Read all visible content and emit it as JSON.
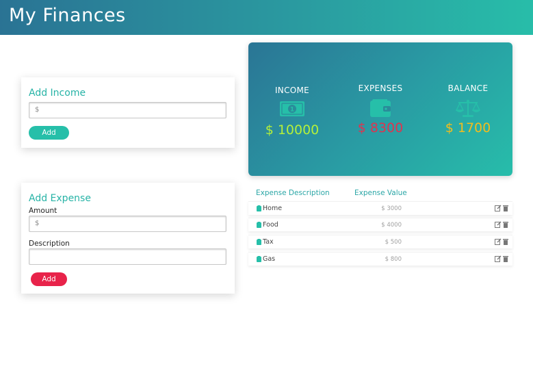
{
  "header": {
    "title": "My Finances"
  },
  "income_form": {
    "title": "Add Income",
    "amount_placeholder": "$",
    "add_label": "Add"
  },
  "expense_form": {
    "title": "Add Expense",
    "amount_label": "Amount",
    "amount_placeholder": "$",
    "description_label": "Description",
    "description_value": "",
    "add_label": "Add"
  },
  "summary": {
    "income": {
      "label": "INCOME",
      "value": "$ 10000",
      "icon": "money-icon",
      "color": "#b4f03a"
    },
    "expenses": {
      "label": "EXPENSES",
      "value": "$ 8300",
      "icon": "wallet-icon",
      "color": "#e0334e"
    },
    "balance": {
      "label": "BALANCE",
      "value": "$ 1700",
      "icon": "balance-scale-icon",
      "color": "#f2bd1d"
    }
  },
  "expense_table": {
    "headers": [
      "Expense Description",
      "Expense Value"
    ],
    "rows": [
      {
        "description": "Home",
        "value": "$ 3000"
      },
      {
        "description": "Food",
        "value": "$ 4000"
      },
      {
        "description": "Tax",
        "value": "$ 500"
      },
      {
        "description": "Gas",
        "value": "$ 800"
      }
    ]
  },
  "colors": {
    "accent_teal": "#26bfa9",
    "danger_red": "#e8234a",
    "header_gradient_start": "#2a7394",
    "header_gradient_end": "#28bda9"
  }
}
